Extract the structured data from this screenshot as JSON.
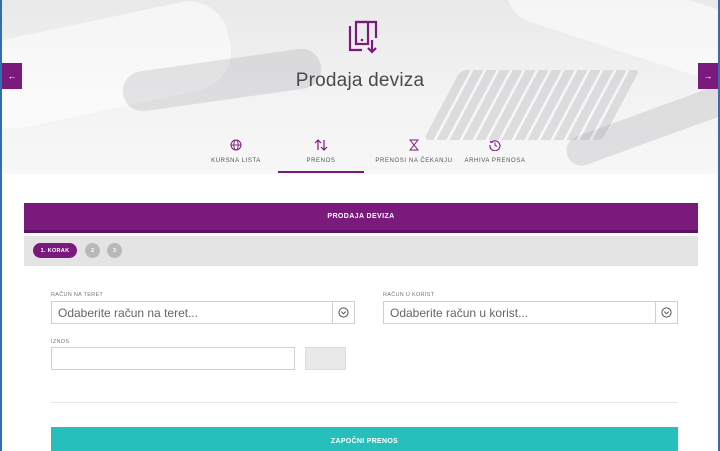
{
  "header": {
    "title": "Prodaja deviza",
    "hero_icon": "phone-download-icon",
    "prev_arrow": "←",
    "next_arrow": "→"
  },
  "tabs": [
    {
      "label": "KURSNA LISTA",
      "icon": "globe-icon",
      "active": false
    },
    {
      "label": "PRENOS",
      "icon": "transfer-arrows-icon",
      "active": true
    },
    {
      "label": "PRENOSI NA ČEKANJU",
      "icon": "hourglass-icon",
      "active": false
    },
    {
      "label": "ARHIVA PRENOSA",
      "icon": "history-icon",
      "active": false
    }
  ],
  "section": {
    "title": "PRODAJA DEVIZA"
  },
  "steps": {
    "active_label": "1. KORAK",
    "step2": "2",
    "step3": "3"
  },
  "form": {
    "debit_label": "RAČUN NA TERET",
    "debit_placeholder": "Odaberite račun na teret...",
    "credit_label": "RAČUN U KORIST",
    "credit_placeholder": "Odaberite račun u korist...",
    "amount_label": "IZNOS",
    "amount_value": "",
    "currency_value": ""
  },
  "actions": {
    "start_label": "ZAPOČNI PRENOS"
  },
  "colors": {
    "brand_purple": "#7a1a7d",
    "teal_button": "#26bfbb",
    "frame_blue": "#2f6fb0"
  }
}
